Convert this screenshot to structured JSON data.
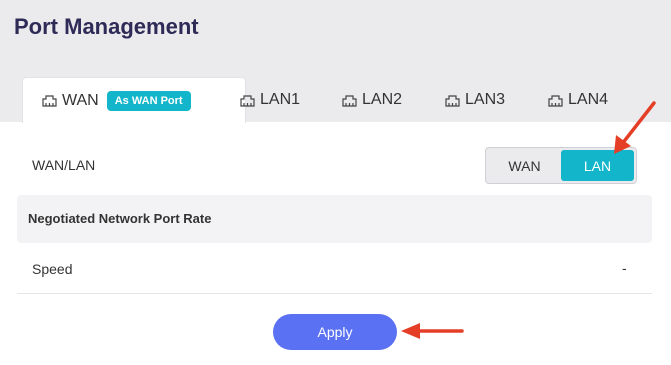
{
  "page": {
    "title": "Port Management"
  },
  "tabs": [
    {
      "label": "WAN",
      "badge": "As WAN Port",
      "icon": "ethernet-port-icon",
      "active": true
    },
    {
      "label": "LAN1",
      "icon": "ethernet-port-icon",
      "active": false
    },
    {
      "label": "LAN2",
      "icon": "ethernet-port-icon",
      "active": false
    },
    {
      "label": "LAN3",
      "icon": "ethernet-port-icon",
      "active": false
    },
    {
      "label": "LAN4",
      "icon": "ethernet-port-icon",
      "active": false
    }
  ],
  "port_mode": {
    "label": "WAN/LAN",
    "options": [
      "WAN",
      "LAN"
    ],
    "selected": "LAN"
  },
  "rate_section": {
    "title": "Negotiated Network Port Rate",
    "speed_label": "Speed",
    "speed_value": "-"
  },
  "actions": {
    "apply_label": "Apply"
  },
  "colors": {
    "accent": "#12b5c9",
    "primary_button": "#5b71f3",
    "title": "#2e2b57",
    "annotation_arrow": "#e53e26"
  }
}
